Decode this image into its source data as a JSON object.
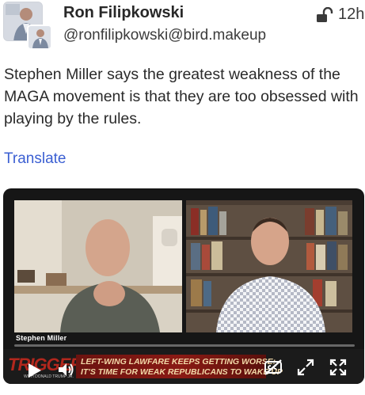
{
  "account": {
    "display_name": "Ron Filipkowski",
    "handle": "@ronfilipkowski@bird.makeup",
    "time": "12h",
    "visibility_icon": "unlock-icon"
  },
  "status": {
    "text": "Stephen Miller says the greatest weakness of the MAGA movement is that they are too obsessed with playing by the rules.",
    "translate_label": "Translate"
  },
  "video": {
    "speaker_label": "Stephen Miller",
    "progress": 0.0,
    "logo_text": "TRIGGERED",
    "logo_subtitle": "WITH DONALD TRUMP JR.",
    "ticker_line1": "LEFT-WING LAWFARE KEEPS GETTING WORSE:",
    "ticker_line2": "IT'S TIME FOR WEAK REPUBLICANS TO WAKE UP",
    "controls": [
      "play-icon",
      "volume-icon",
      "closed-captions-off-icon",
      "picture-in-picture-icon",
      "fullscreen-icon"
    ]
  },
  "colors": {
    "link": "#3b5fd2",
    "logo_red": "#b2271d",
    "ticker_bg": "#8a1a14"
  }
}
